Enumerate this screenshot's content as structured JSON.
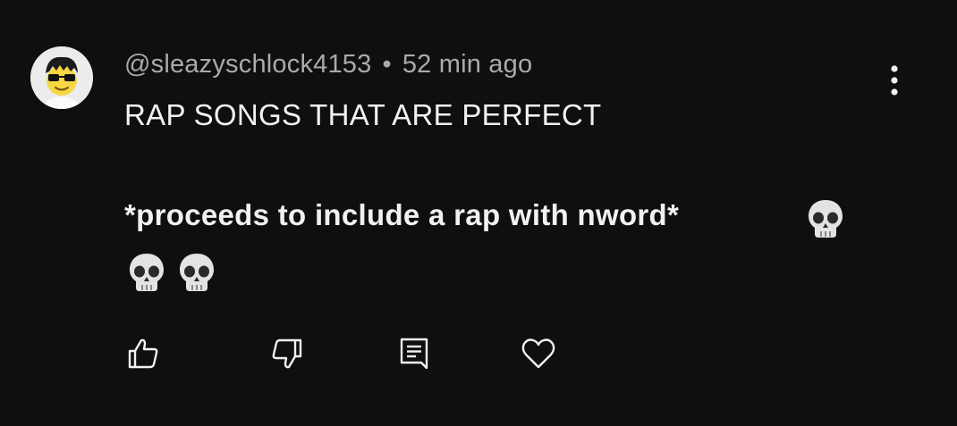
{
  "comment": {
    "author": "@sleazyschlock4153",
    "separator": "•",
    "timestamp": "52 min ago",
    "text_line_1": "RAP SONGS THAT ARE PERFECT",
    "text_line_2": "*proceeds to include a rap with nword*",
    "emojis": [
      "skull",
      "skull",
      "skull"
    ]
  },
  "actions": {
    "icons": [
      "thumbs-up-icon",
      "thumbs-down-icon",
      "reply-icon",
      "heart-icon"
    ]
  },
  "colors": {
    "background": "#0f0f0f",
    "primary_text": "#f1f1f1",
    "secondary_text": "#aaaaaa"
  }
}
